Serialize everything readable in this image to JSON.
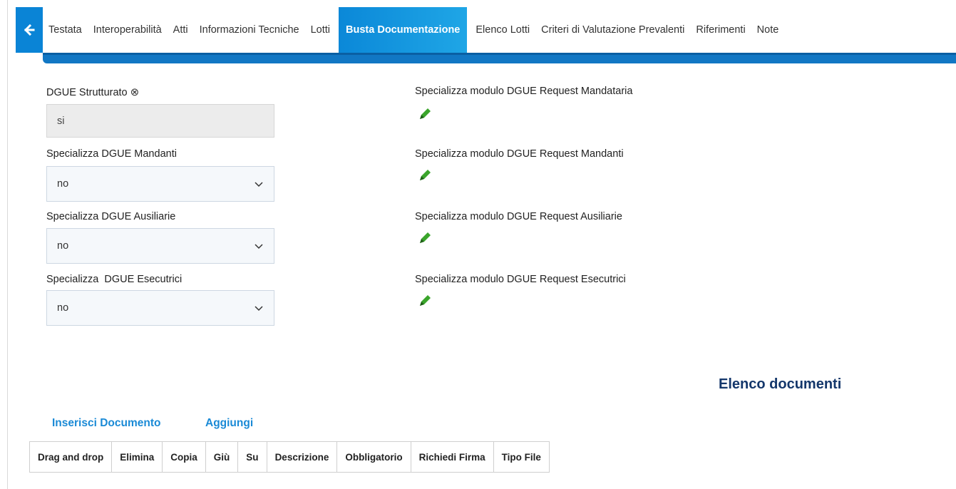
{
  "tabbar": {
    "tabs": [
      {
        "label": "Testata"
      },
      {
        "label": "Interoperabilità"
      },
      {
        "label": "Atti"
      },
      {
        "label": "Informazioni Tecniche"
      },
      {
        "label": "Lotti"
      },
      {
        "label": "Busta Documentazione",
        "active": true
      },
      {
        "label": "Elenco Lotti"
      },
      {
        "label": "Criteri di Valutazione Prevalenti"
      },
      {
        "label": "Riferimenti"
      },
      {
        "label": "Note"
      }
    ],
    "accent_color": "#0a84d6"
  },
  "form": {
    "dgue_strutturato": {
      "label": "DGUE Strutturato",
      "icon": "circled-x-icon",
      "value": "si"
    },
    "mandanti": {
      "label": "Specializza DGUE Mandanti",
      "value": "no"
    },
    "ausiliarie": {
      "label": "Specializza DGUE Ausiliarie",
      "value": "no"
    },
    "esecutrici": {
      "label": "Specializza  DGUE Esecutrici",
      "value": "no"
    },
    "modulo_mandataria": {
      "label": "Specializza modulo DGUE Request Mandataria",
      "icon": "pencil-icon"
    },
    "modulo_mandanti": {
      "label": "Specializza modulo DGUE Request Mandanti",
      "icon": "pencil-icon"
    },
    "modulo_ausiliarie": {
      "label": "Specializza modulo DGUE Request Ausiliarie",
      "icon": "pencil-icon"
    },
    "modulo_esecutrici": {
      "label": "Specializza modulo DGUE Request Esecutrici",
      "icon": "pencil-icon"
    }
  },
  "documents": {
    "title": "Elenco documenti",
    "insert_label": "Inserisci Documento",
    "add_label": "Aggiungi",
    "columns": [
      "Drag and drop",
      "Elimina",
      "Copia",
      "Giù",
      "Su",
      "Descrizione",
      "Obbligatorio",
      "Richiedi Firma",
      "Tipo File"
    ]
  }
}
